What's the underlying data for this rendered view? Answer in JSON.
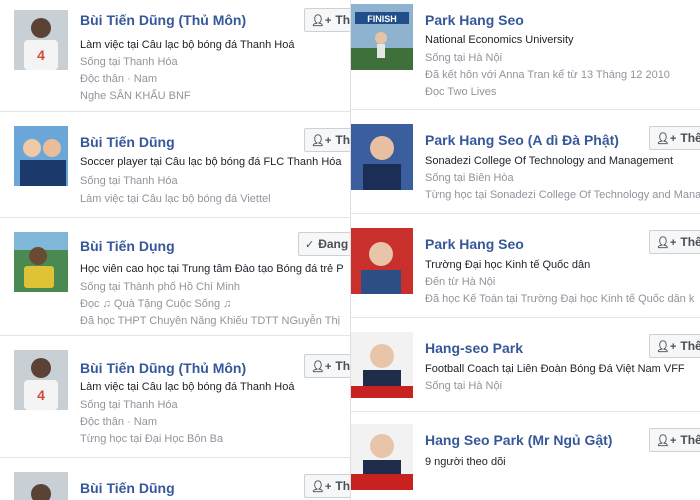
{
  "add_friend_label": "Thêm",
  "friends_label": "Đang",
  "left": [
    {
      "name": "Bùi Tiến Dũng (Thủ Môn)",
      "lines": [
        "Làm việc tại Câu lạc bộ bóng đá Thanh Hoá",
        "Sống tại Thanh Hóa",
        "Độc thân · Nam",
        "Nghe SÂN KHẤU BNF"
      ],
      "button": "add",
      "photo_colors": [
        "#b8c3cc",
        "#d24a3c",
        "#f1f1f1"
      ]
    },
    {
      "name": "Bùi Tiến Dũng",
      "lines": [
        "Soccer player tại Câu lạc bộ bóng đá FLC Thanh Hóa",
        "Sống tại Thanh Hóa",
        "Làm việc tại Câu lạc bộ bóng đá Viettel"
      ],
      "button": "add",
      "photo_colors": [
        "#6aa6d8",
        "#1b3a6b",
        "#f0c9a7"
      ]
    },
    {
      "name": "Bùi Tiến Dụng",
      "lines": [
        "Học viên cao học tại Trung tâm Đào tạo Bóng đá trẻ P",
        "Sống tại Thành phố Hồ Chí Minh",
        "Đọc ♫ Quà Tặng Cuộc Sống ♫",
        "Đã học THPT Chuyên Năng Khiếu TDTT NGuyễn Thị"
      ],
      "button": "friends",
      "photo_colors": [
        "#3f7a45",
        "#e0c236",
        "#2a2a2a"
      ]
    },
    {
      "name": "Bùi Tiến Dũng (Thủ Môn)",
      "lines": [
        "Làm việc tại Câu lạc bộ bóng đá Thanh Hoá",
        "Sống tại Thanh Hóa",
        "Độc thân · Nam",
        "Từng học tại Đại Học Bôn Ba"
      ],
      "button": "add",
      "photo_colors": [
        "#b8c3cc",
        "#d24a3c",
        "#f1f1f1"
      ]
    },
    {
      "name": "Bùi Tiến Dũng",
      "lines": [],
      "button": "add",
      "photo_colors": [
        "#b8c3cc",
        "#d24a3c",
        "#f1f1f1"
      ]
    }
  ],
  "right": [
    {
      "name": "Park Hang Seo",
      "lines": [
        "National Economics University",
        "Sống tại Hà Nội",
        "Đã kết hôn với Anna Tran kể từ 13 Tháng 12 2010",
        "Đọc Two Lives"
      ],
      "button": "add",
      "photo_colors": [
        "#8fb3cf",
        "#3f6f3a",
        "#e6e6e6"
      ],
      "photo_text": "FINISH"
    },
    {
      "name": "Park Hang Seo (A dì Đà Phật)",
      "lines": [
        "Sonadezi College Of Technology and Management",
        "Sống tại Biên Hòa",
        "Từng học tại Sonadezi College Of Technology and Management"
      ],
      "button": "add",
      "photo_colors": [
        "#3b5f9e",
        "#e8bfa0",
        "#1c2e55"
      ]
    },
    {
      "name": "Park Hang Seo",
      "lines": [
        "Trường Đại học Kinh tế Quốc dân",
        "Đến từ Hà Nội",
        "Đã học Kế Toán tại Trường Đại học Kinh tế Quốc dân k"
      ],
      "button": "add",
      "photo_colors": [
        "#c9302c",
        "#2d4f86",
        "#e8c4a8"
      ]
    },
    {
      "name": "Hang-seo Park",
      "lines": [
        "Football Coach tại Liên Đoàn Bóng Đá Việt Nam VFF",
        "Sống tại Hà Nội"
      ],
      "button": "add",
      "photo_colors": [
        "#f2f2f2",
        "#c7221f",
        "#1f2d4a"
      ]
    },
    {
      "name": "Hang Seo Park (Mr Ngủ Gật)",
      "lines": [
        "9 người theo dõi"
      ],
      "button": "add",
      "photo_colors": [
        "#f2f2f2",
        "#c7221f",
        "#1f2d4a"
      ]
    }
  ]
}
